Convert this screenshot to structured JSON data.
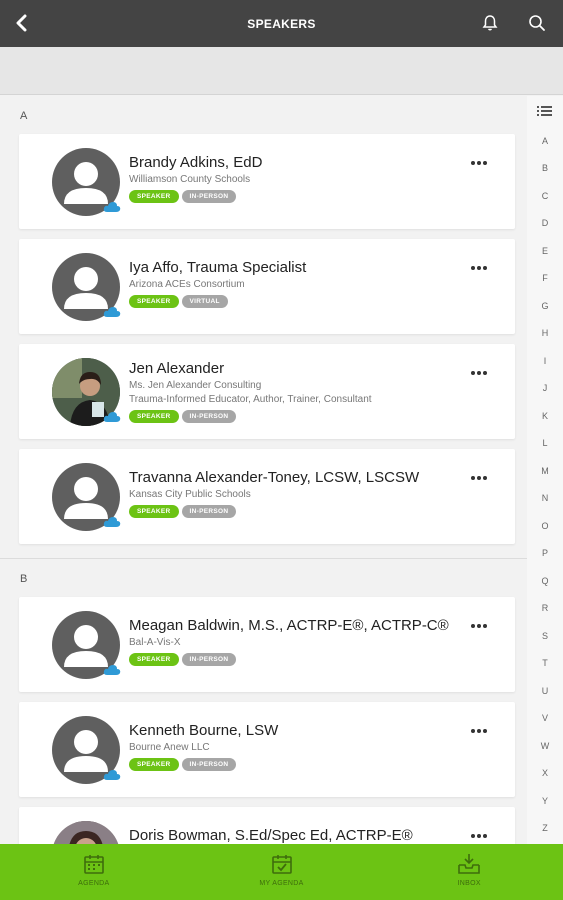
{
  "header": {
    "title": "SPEAKERS"
  },
  "colors": {
    "accent": "#6cc314",
    "header_bg": "#444444",
    "badge_gray": "#a6a6a6",
    "cloud": "#2f9ad6"
  },
  "sections": [
    {
      "letter": "A",
      "speakers": [
        {
          "name": "Brandy Adkins, EdD",
          "org": "Williamson County Schools",
          "role": "",
          "type": "SPEAKER",
          "format": "IN-PERSON",
          "photo": false
        },
        {
          "name": "Iya Affo, Trauma Specialist",
          "org": "Arizona ACEs Consortium",
          "role": "",
          "type": "SPEAKER",
          "format": "VIRTUAL",
          "photo": false
        },
        {
          "name": "Jen Alexander",
          "org": "Ms. Jen Alexander Consulting",
          "role": "Trauma-Informed Educator, Author, Trainer, Consultant",
          "type": "SPEAKER",
          "format": "IN-PERSON",
          "photo": true
        },
        {
          "name": "Travanna Alexander-Toney, LCSW, LSCSW",
          "org": "Kansas City Public Schools",
          "role": "",
          "type": "SPEAKER",
          "format": "IN-PERSON",
          "photo": false
        }
      ]
    },
    {
      "letter": "B",
      "speakers": [
        {
          "name": "Meagan Baldwin, M.S., ACTRP-E®, ACTRP-C®",
          "org": "Bal-A-Vis-X",
          "role": "",
          "type": "SPEAKER",
          "format": "IN-PERSON",
          "photo": false
        },
        {
          "name": "Kenneth Bourne, LSW",
          "org": "Bourne Anew LLC",
          "role": "",
          "type": "SPEAKER",
          "format": "IN-PERSON",
          "photo": false
        },
        {
          "name": "Doris Bowman, S.Ed/Spec Ed, ACTRP-E®",
          "org": "",
          "role": "",
          "type": "",
          "format": "",
          "photo": true
        }
      ]
    }
  ],
  "index_letters": [
    "A",
    "B",
    "C",
    "D",
    "E",
    "F",
    "G",
    "H",
    "I",
    "J",
    "K",
    "L",
    "M",
    "N",
    "O",
    "P",
    "Q",
    "R",
    "S",
    "T",
    "U",
    "V",
    "W",
    "X",
    "Y",
    "Z"
  ],
  "bottom_nav": [
    {
      "label": "AGENDA",
      "icon": "calendar-icon"
    },
    {
      "label": "MY AGENDA",
      "icon": "calendar-check-icon"
    },
    {
      "label": "INBOX",
      "icon": "inbox-download-icon"
    }
  ]
}
